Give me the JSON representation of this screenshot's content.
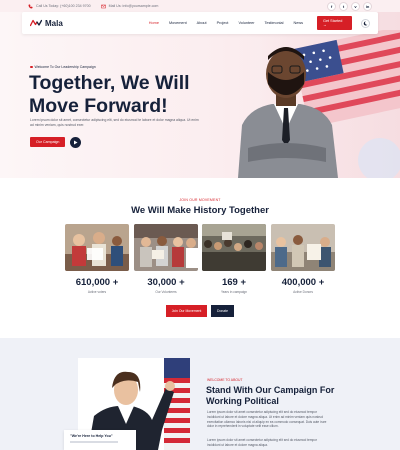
{
  "topbar": {
    "phone": "Call Us Today: (+60)100 234 9700",
    "email": "Mail Us: info@yoursample.com",
    "socials": [
      {
        "icon": "facebook-icon",
        "glyph": "f"
      },
      {
        "icon": "twitter-icon",
        "glyph": "t"
      },
      {
        "icon": "vimeo-icon",
        "glyph": "v"
      },
      {
        "icon": "linkedin-icon",
        "glyph": "in"
      }
    ]
  },
  "brand": {
    "name": "Mala",
    "red": "#d61f26",
    "navy": "#16213a"
  },
  "nav": {
    "items": [
      "Home",
      "Movement",
      "About",
      "Project",
      "Volunteer",
      "Testimonial",
      "News"
    ],
    "active": "Home",
    "cta": "Get Started →"
  },
  "hero": {
    "subtitle": "Welcome To Our Leadership Campaign",
    "title_line1": "Together, We Will",
    "title_line2": "Move Forward!",
    "description": "Lorem ipsum dolor sit amet, consectetur adipiscing elit, sed do eiusmod te labore et dolor magna aliqua. Ut enim ad minim veniam, quis nostrud exer.",
    "button": "Our Campaign"
  },
  "movement": {
    "eyebrow": "JOIN OUR MOVEMENT",
    "title": "We Will Make History Together",
    "stats": [
      {
        "value": "610,000 +",
        "label": "Active voters"
      },
      {
        "value": "30,000 +",
        "label": "Our Volunteers"
      },
      {
        "value": "169 +",
        "label": "Years in campaign"
      },
      {
        "value": "400,000 +",
        "label": "Active Donors"
      }
    ],
    "join_button": "Join Our Movement",
    "donate_button": "Donate"
  },
  "about": {
    "eyebrow": "WELCOME TO ABOUT",
    "title_line1": "Stand With Our Campaign For",
    "title_line2": "Working Political",
    "para1": "Lorem ipsum dolor sit amet consectetur adipiscing elit sed do eiusmod tempor incididunt ut labore et dolore magna aliqua. Ut enim ad minim veniam quis nostrud exercitation ullamco laboris nisi ut aliquip ex ea commodo consequat. Duis aute irure dolor in reprehenderit in voluptate velit esse cillum.",
    "para2": "Lorem ipsum dolor sit amet consectetur adipiscing elit sed do eiusmod tempor incididunt ut labore et dolore magna aliqua.",
    "help_card": "\"We're Here to Help You\""
  }
}
